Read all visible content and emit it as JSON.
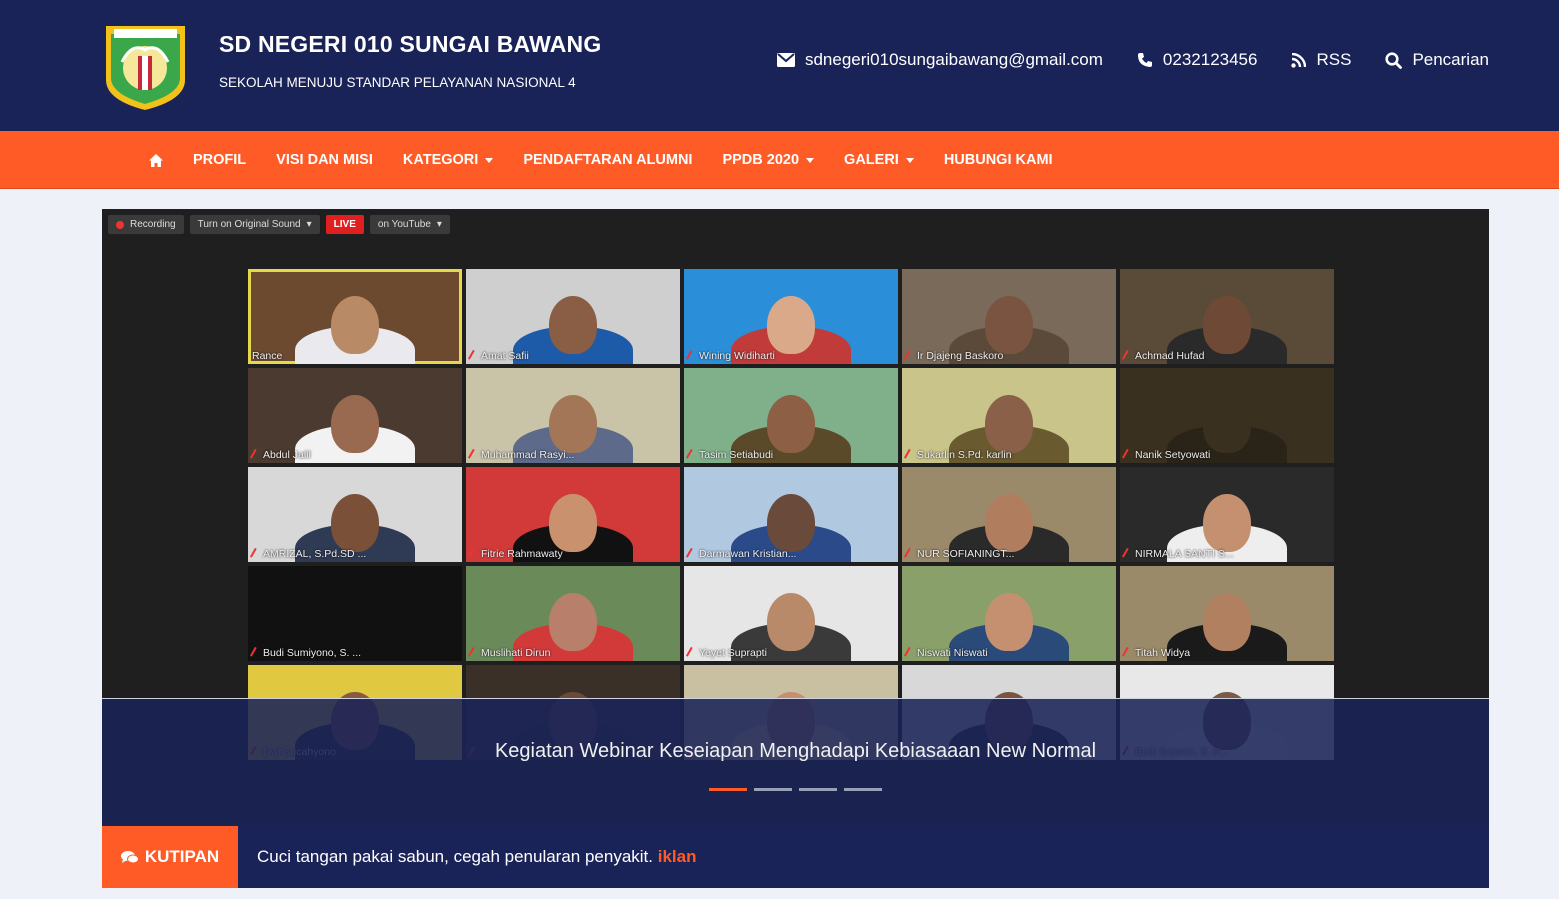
{
  "header": {
    "title": "SD NEGERI 010 SUNGAI BAWANG",
    "subtitle": "SEKOLAH MENUJU STANDAR PELAYANAN NASIONAL 4",
    "email": "sdnegeri010sungaibawang@gmail.com",
    "phone": "0232123456",
    "rss": "RSS",
    "search": "Pencarian"
  },
  "nav": {
    "items": [
      "PROFIL",
      "VISI DAN MISI",
      "KATEGORI",
      "PENDAFTARAN ALUMNI",
      "PPDB 2020",
      "GALERI",
      "HUBUNGI KAMI"
    ]
  },
  "slider": {
    "zoom_bar": {
      "recording": "Recording",
      "sound": "Turn on Original Sound",
      "live": "LIVE",
      "youtube": "on YouTube"
    },
    "participants": [
      {
        "name": "Rance",
        "bg": "#6b4a30",
        "skin": "#b88a66",
        "shirt": "#e9e9ee"
      },
      {
        "name": "Amat Safii",
        "bg": "#cfcfcf",
        "skin": "#8a5e44",
        "shirt": "#1d5aa8"
      },
      {
        "name": "Wining Widiharti",
        "bg": "#2a8fd8",
        "skin": "#d9a98a",
        "shirt": "#c23b3b"
      },
      {
        "name": "Ir Djajeng Baskoro",
        "bg": "#7a6a5a",
        "skin": "#7a5440",
        "shirt": "#5b4a3a"
      },
      {
        "name": "Achmad Hufad",
        "bg": "#5a4a38",
        "skin": "#6e4a36",
        "shirt": "#2a2a2a"
      },
      {
        "name": "Abdul Jalil",
        "bg": "#4a3a30",
        "skin": "#9a6a50",
        "shirt": "#f2f2f2"
      },
      {
        "name": "Muhammad Rasyi...",
        "bg": "#c9c3a8",
        "skin": "#a27656",
        "shirt": "#5d6a8a"
      },
      {
        "name": "Tasim Setiabudi",
        "bg": "#7fb08a",
        "skin": "#8d5f44",
        "shirt": "#5a4a2a"
      },
      {
        "name": "Sukarlin S.Pd. karlin",
        "bg": "#c9c48a",
        "skin": "#8a6048",
        "shirt": "#6a5a30"
      },
      {
        "name": "Nanik Setyowati",
        "bg": "#3a3020",
        "skin": "#3a3020",
        "shirt": "#2a2418"
      },
      {
        "name": "AMRIZAL, S.Pd.SD ...",
        "bg": "#d8d8d8",
        "skin": "#7a5038",
        "shirt": "#2f3a54"
      },
      {
        "name": "Fitrie Rahmawaty",
        "bg": "#d23a3a",
        "skin": "#c9916e",
        "shirt": "#111111"
      },
      {
        "name": "Darmawan Kristian...",
        "bg": "#b0c8e0",
        "skin": "#6a4a3a",
        "shirt": "#2a4a8a"
      },
      {
        "name": "NUR SOFIANINGT...",
        "bg": "#9a8a6a",
        "skin": "#b07e5e",
        "shirt": "#2a2a2a"
      },
      {
        "name": "NIRMALA SANTI S...",
        "bg": "#2a2a2a",
        "skin": "#c49070",
        "shirt": "#eeeeee"
      },
      {
        "name": "Budi Sumiyono, S. ...",
        "bg": "#111111",
        "skin": "#111111",
        "shirt": "#111111"
      },
      {
        "name": "Muslihati Dirun",
        "bg": "#6a8a5a",
        "skin": "#b8806a",
        "shirt": "#d23a3a"
      },
      {
        "name": "Yeyet Suprapti",
        "bg": "#e6e6e6",
        "skin": "#b88a6a",
        "shirt": "#3a3a3a"
      },
      {
        "name": "Niswati Niswati",
        "bg": "#8aa06a",
        "skin": "#c49070",
        "shirt": "#2a4a7a"
      },
      {
        "name": "Titah Widya",
        "bg": "#9a8a6a",
        "skin": "#b08060",
        "shirt": "#1a1a1a"
      },
      {
        "name": "Dwi Sucahyono",
        "bg": "#e0c840",
        "skin": "#8a5a40",
        "shirt": "#2a2a2a"
      },
      {
        "name": "",
        "bg": "#3a3028",
        "skin": "#6a4a38",
        "shirt": "#2a2a2a"
      },
      {
        "name": "",
        "bg": "#c8c0a0",
        "skin": "#c49070",
        "shirt": "#f0e6a0"
      },
      {
        "name": "",
        "bg": "#d8d8d8",
        "skin": "#7a5440",
        "shirt": "#2a2a2a"
      },
      {
        "name": "Budi Srijanto, S. P...",
        "bg": "#e8e8e8",
        "skin": "#7a5a48",
        "shirt": "#f0f0f0"
      }
    ],
    "caption": "Kegiatan Webinar Keseiapan Menghadapi Kebiasaaan New Normal",
    "active_slide": 0,
    "slide_count": 4
  },
  "kutipan": {
    "label": "KUTIPAN",
    "text": "Cuci tangan pakai sabun, cegah penularan penyakit.",
    "link": "iklan"
  },
  "colors": {
    "navy": "#1a2358",
    "orange": "#ff5b27"
  }
}
